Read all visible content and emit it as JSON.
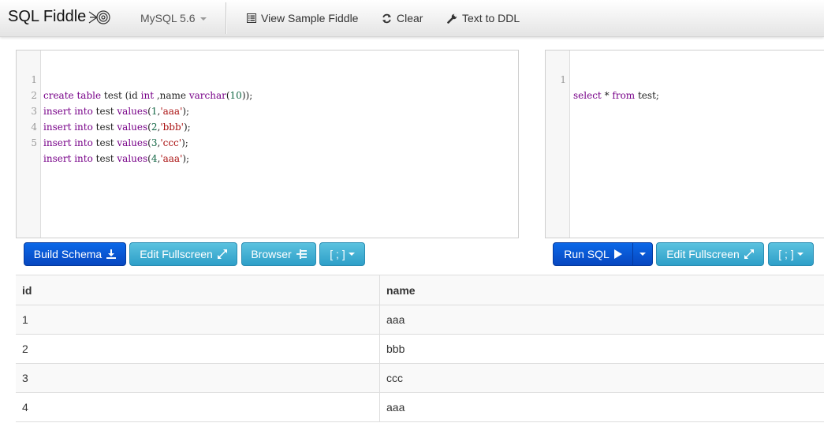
{
  "navbar": {
    "brand": "SQL Fiddle",
    "db_version": "MySQL 5.6",
    "links": [
      {
        "label": "View Sample Fiddle",
        "icon": "list-icon"
      },
      {
        "label": "Clear",
        "icon": "refresh-icon"
      },
      {
        "label": "Text to DDL",
        "icon": "wrench-icon"
      }
    ]
  },
  "schema_editor": {
    "line_numbers": [
      "1",
      "2",
      "3",
      "4",
      "5"
    ],
    "lines": [
      "create table test (id int ,name varchar(10));",
      "insert into test values(1,'aaa');",
      "insert into test values(2,'bbb');",
      "insert into test values(3,'ccc');",
      "insert into test values(4,'aaa');"
    ]
  },
  "query_editor": {
    "line_numbers": [
      "1"
    ],
    "lines": [
      "select * from test;"
    ]
  },
  "schema_buttons": {
    "build": "Build Schema",
    "fullscreen": "Edit Fullscreen",
    "browser": "Browser",
    "terminator": "[ ; ]"
  },
  "query_buttons": {
    "run": "Run SQL",
    "fullscreen": "Edit Fullscreen",
    "terminator": "[ ; ]"
  },
  "colors": {
    "primary": "#0747c0",
    "info": "#2e9fc8",
    "keyword": "#770088",
    "number": "#116644",
    "string": "#aa1111"
  },
  "results": {
    "columns": [
      "id",
      "name"
    ],
    "rows": [
      [
        "1",
        "aaa"
      ],
      [
        "2",
        "bbb"
      ],
      [
        "3",
        "ccc"
      ],
      [
        "4",
        "aaa"
      ]
    ]
  }
}
